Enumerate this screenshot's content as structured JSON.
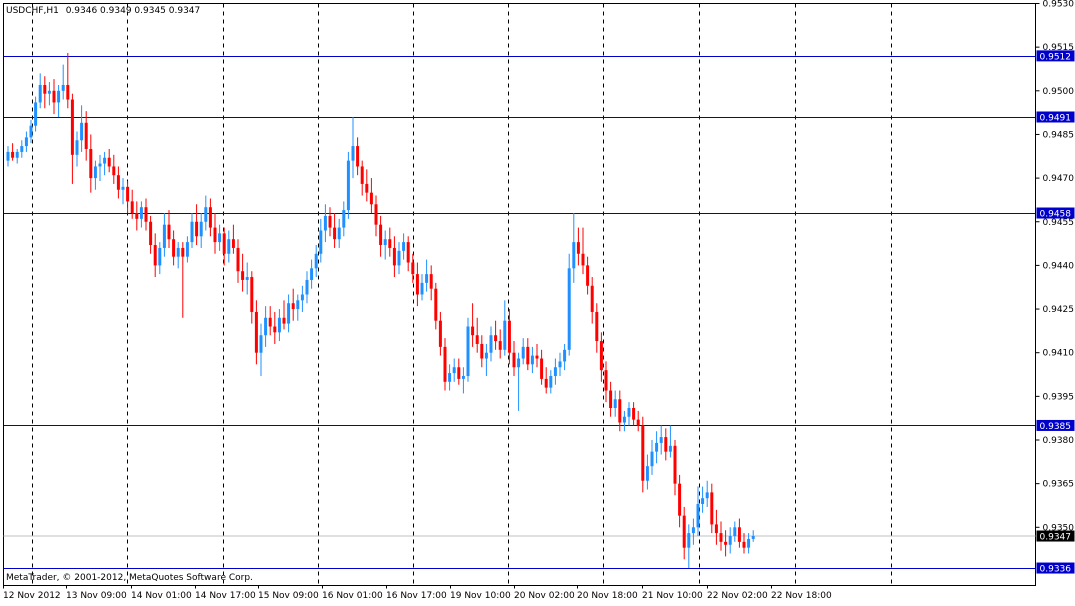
{
  "header": {
    "symbol": "USDCHF,H1",
    "ohlc": "0.9346 0.9349 0.9345 0.9347"
  },
  "footer": {
    "copyright": "MetaTrader, © 2001-2012, MetaQuotes Software Corp."
  },
  "colors": {
    "bull": "#1e90ff",
    "bear": "#ff0000",
    "level_line": "#0000cd",
    "grid": "#000000",
    "axis_text": "#000000",
    "current_price_bg": "#000000",
    "current_price_text": "#ffffff"
  },
  "chart_data": {
    "type": "candlestick",
    "symbol": "USDCHF",
    "timeframe": "H1",
    "title": "USDCHF,H1 0.9346 0.9349 0.9345 0.9347",
    "ylim": [
      0.933,
      0.953
    ],
    "y_ticks": [
      "0.9530",
      "0.9515",
      "0.9500",
      "0.9485",
      "0.9470",
      "0.9455",
      "0.9440",
      "0.9425",
      "0.9410",
      "0.9395",
      "0.9380",
      "0.9365",
      "0.9350"
    ],
    "x_tick_labels": [
      "12 Nov 2012",
      "13 Nov 09:00",
      "14 Nov 01:00",
      "14 Nov 17:00",
      "15 Nov 09:00",
      "16 Nov 01:00",
      "16 Nov 17:00",
      "19 Nov 10:00",
      "20 Nov 02:00",
      "20 Nov 18:00",
      "21 Nov 10:00",
      "22 Nov 02:00",
      "22 Nov 18:00"
    ],
    "horizontal_levels": [
      {
        "value": 0.9512,
        "label": "0.9512"
      },
      {
        "value": 0.9491,
        "label": "0.9491"
      },
      {
        "value": 0.9458,
        "label": "0.9458"
      },
      {
        "value": 0.9385,
        "label": "0.9385"
      },
      {
        "value": 0.9336,
        "label": "0.9336"
      }
    ],
    "current_price": {
      "value": 0.9347,
      "label": "0.9347"
    },
    "grid": "vertical-dashed",
    "candles": [
      [
        0.9476,
        0.9481,
        0.9474,
        0.9479
      ],
      [
        0.9479,
        0.9482,
        0.9476,
        0.9477
      ],
      [
        0.9477,
        0.948,
        0.9475,
        0.9479
      ],
      [
        0.9479,
        0.9483,
        0.9477,
        0.9481
      ],
      [
        0.9481,
        0.9486,
        0.9479,
        0.9484
      ],
      [
        0.9484,
        0.949,
        0.9482,
        0.9488
      ],
      [
        0.9488,
        0.9498,
        0.9486,
        0.9496
      ],
      [
        0.9496,
        0.9506,
        0.9494,
        0.9502
      ],
      [
        0.9502,
        0.9505,
        0.9494,
        0.9499
      ],
      [
        0.9499,
        0.9503,
        0.9495,
        0.95
      ],
      [
        0.95,
        0.9504,
        0.9492,
        0.9496
      ],
      [
        0.9496,
        0.9502,
        0.9491,
        0.95
      ],
      [
        0.95,
        0.9509,
        0.9497,
        0.9502
      ],
      [
        0.9502,
        0.9513,
        0.9494,
        0.9497
      ],
      [
        0.9497,
        0.9499,
        0.9468,
        0.9478
      ],
      [
        0.9478,
        0.9486,
        0.9474,
        0.9483
      ],
      [
        0.9483,
        0.9495,
        0.9479,
        0.9489
      ],
      [
        0.9489,
        0.9493,
        0.9476,
        0.948
      ],
      [
        0.948,
        0.9485,
        0.9465,
        0.947
      ],
      [
        0.947,
        0.9476,
        0.9466,
        0.9474
      ],
      [
        0.9474,
        0.9478,
        0.9469,
        0.9475
      ],
      [
        0.9475,
        0.9479,
        0.9471,
        0.9477
      ],
      [
        0.9477,
        0.948,
        0.9472,
        0.9474
      ],
      [
        0.9474,
        0.9478,
        0.9468,
        0.9471
      ],
      [
        0.9471,
        0.9474,
        0.9463,
        0.9466
      ],
      [
        0.9466,
        0.947,
        0.9461,
        0.9467
      ],
      [
        0.9467,
        0.9469,
        0.9458,
        0.9462
      ],
      [
        0.9462,
        0.9466,
        0.9456,
        0.9458
      ],
      [
        0.9458,
        0.9462,
        0.9452,
        0.9456
      ],
      [
        0.9456,
        0.9462,
        0.9453,
        0.946
      ],
      [
        0.946,
        0.9463,
        0.9452,
        0.9455
      ],
      [
        0.9455,
        0.9457,
        0.9444,
        0.9447
      ],
      [
        0.9447,
        0.9451,
        0.9436,
        0.944
      ],
      [
        0.944,
        0.9448,
        0.9437,
        0.9446
      ],
      [
        0.9446,
        0.9458,
        0.9443,
        0.9454
      ],
      [
        0.9454,
        0.9459,
        0.9446,
        0.9449
      ],
      [
        0.9449,
        0.9452,
        0.944,
        0.9443
      ],
      [
        0.9443,
        0.9448,
        0.9439,
        0.9446
      ],
      [
        0.9446,
        0.9448,
        0.9422,
        0.9443
      ],
      [
        0.9443,
        0.945,
        0.9441,
        0.9448
      ],
      [
        0.9448,
        0.9458,
        0.9446,
        0.9455
      ],
      [
        0.9455,
        0.9461,
        0.9447,
        0.945
      ],
      [
        0.945,
        0.9458,
        0.9446,
        0.9455
      ],
      [
        0.9455,
        0.9464,
        0.9452,
        0.946
      ],
      [
        0.946,
        0.9463,
        0.945,
        0.9453
      ],
      [
        0.9453,
        0.9458,
        0.9444,
        0.9448
      ],
      [
        0.9448,
        0.9454,
        0.9445,
        0.9451
      ],
      [
        0.9451,
        0.9453,
        0.944,
        0.9444
      ],
      [
        0.9444,
        0.9452,
        0.9441,
        0.9449
      ],
      [
        0.9449,
        0.9454,
        0.9444,
        0.9446
      ],
      [
        0.9446,
        0.9449,
        0.9434,
        0.9438
      ],
      [
        0.9438,
        0.9444,
        0.9431,
        0.9435
      ],
      [
        0.9435,
        0.9441,
        0.943,
        0.9436
      ],
      [
        0.9436,
        0.9438,
        0.942,
        0.9424
      ],
      [
        0.9424,
        0.9428,
        0.9406,
        0.941
      ],
      [
        0.941,
        0.942,
        0.9402,
        0.9416
      ],
      [
        0.9416,
        0.9426,
        0.9412,
        0.9422
      ],
      [
        0.9422,
        0.9426,
        0.9416,
        0.9419
      ],
      [
        0.9419,
        0.9424,
        0.9413,
        0.9417
      ],
      [
        0.9417,
        0.9425,
        0.9414,
        0.9422
      ],
      [
        0.9422,
        0.9428,
        0.9418,
        0.942
      ],
      [
        0.942,
        0.943,
        0.9417,
        0.9427
      ],
      [
        0.9427,
        0.9432,
        0.9421,
        0.9425
      ],
      [
        0.9425,
        0.943,
        0.9421,
        0.9428
      ],
      [
        0.9428,
        0.9433,
        0.9424,
        0.943
      ],
      [
        0.943,
        0.9438,
        0.9427,
        0.9435
      ],
      [
        0.9435,
        0.9442,
        0.9432,
        0.9439
      ],
      [
        0.9439,
        0.9447,
        0.9436,
        0.9444
      ],
      [
        0.9444,
        0.9456,
        0.9441,
        0.9452
      ],
      [
        0.9452,
        0.9461,
        0.9448,
        0.9457
      ],
      [
        0.9457,
        0.946,
        0.945,
        0.9453
      ],
      [
        0.9453,
        0.9458,
        0.9446,
        0.9449
      ],
      [
        0.9449,
        0.9456,
        0.9446,
        0.9453
      ],
      [
        0.9453,
        0.9462,
        0.945,
        0.9459
      ],
      [
        0.9459,
        0.9479,
        0.9456,
        0.9476
      ],
      [
        0.9476,
        0.9491,
        0.947,
        0.9481
      ],
      [
        0.9481,
        0.9484,
        0.9471,
        0.9474
      ],
      [
        0.9474,
        0.9476,
        0.9464,
        0.9468
      ],
      [
        0.9468,
        0.9473,
        0.9462,
        0.9465
      ],
      [
        0.9465,
        0.947,
        0.9458,
        0.9461
      ],
      [
        0.9461,
        0.9464,
        0.945,
        0.9454
      ],
      [
        0.9454,
        0.9457,
        0.9443,
        0.9447
      ],
      [
        0.9447,
        0.9452,
        0.9442,
        0.9449
      ],
      [
        0.9449,
        0.9453,
        0.9443,
        0.9446
      ],
      [
        0.9446,
        0.945,
        0.9436,
        0.944
      ],
      [
        0.944,
        0.9448,
        0.9437,
        0.9445
      ],
      [
        0.9445,
        0.9451,
        0.9442,
        0.9448
      ],
      [
        0.9448,
        0.945,
        0.9438,
        0.9441
      ],
      [
        0.9441,
        0.9444,
        0.9434,
        0.9437
      ],
      [
        0.9437,
        0.9441,
        0.9426,
        0.943
      ],
      [
        0.943,
        0.9437,
        0.9428,
        0.9434
      ],
      [
        0.9434,
        0.9442,
        0.9431,
        0.9437
      ],
      [
        0.9437,
        0.944,
        0.9428,
        0.9432
      ],
      [
        0.9432,
        0.9434,
        0.9418,
        0.9421
      ],
      [
        0.9421,
        0.9424,
        0.9409,
        0.9412
      ],
      [
        0.9412,
        0.9415,
        0.9397,
        0.94
      ],
      [
        0.94,
        0.9406,
        0.9397,
        0.9403
      ],
      [
        0.9403,
        0.9408,
        0.94,
        0.9405
      ],
      [
        0.9405,
        0.9408,
        0.9399,
        0.9401
      ],
      [
        0.9401,
        0.9405,
        0.9396,
        0.9402
      ],
      [
        0.9402,
        0.9422,
        0.94,
        0.9419
      ],
      [
        0.9419,
        0.9427,
        0.9412,
        0.9416
      ],
      [
        0.9416,
        0.9422,
        0.941,
        0.9413
      ],
      [
        0.9413,
        0.9416,
        0.9405,
        0.9408
      ],
      [
        0.9408,
        0.9413,
        0.9402,
        0.941
      ],
      [
        0.941,
        0.9419,
        0.9407,
        0.9416
      ],
      [
        0.9416,
        0.9421,
        0.9411,
        0.9414
      ],
      [
        0.9414,
        0.9418,
        0.9408,
        0.9411
      ],
      [
        0.9411,
        0.9428,
        0.9409,
        0.9421
      ],
      [
        0.9421,
        0.9425,
        0.9406,
        0.941
      ],
      [
        0.941,
        0.9414,
        0.9402,
        0.9405
      ],
      [
        0.9405,
        0.941,
        0.939,
        0.9408
      ],
      [
        0.9408,
        0.9415,
        0.9406,
        0.9412
      ],
      [
        0.9412,
        0.9415,
        0.9404,
        0.9406
      ],
      [
        0.9406,
        0.9412,
        0.9403,
        0.9409
      ],
      [
        0.9409,
        0.9413,
        0.9405,
        0.9408
      ],
      [
        0.9408,
        0.9411,
        0.9399,
        0.9401
      ],
      [
        0.9401,
        0.9405,
        0.9396,
        0.9398
      ],
      [
        0.9398,
        0.9404,
        0.9396,
        0.9402
      ],
      [
        0.9402,
        0.9408,
        0.9399,
        0.9405
      ],
      [
        0.9405,
        0.941,
        0.9402,
        0.9407
      ],
      [
        0.9407,
        0.9413,
        0.9404,
        0.9411
      ],
      [
        0.9411,
        0.9444,
        0.9409,
        0.9439
      ],
      [
        0.9439,
        0.9458,
        0.9434,
        0.9448
      ],
      [
        0.9448,
        0.9453,
        0.944,
        0.9444
      ],
      [
        0.9444,
        0.9453,
        0.9437,
        0.944
      ],
      [
        0.944,
        0.9443,
        0.943,
        0.9433
      ],
      [
        0.9433,
        0.9436,
        0.942,
        0.9424
      ],
      [
        0.9424,
        0.9427,
        0.941,
        0.9414
      ],
      [
        0.9414,
        0.9417,
        0.94,
        0.9404
      ],
      [
        0.9404,
        0.9407,
        0.9393,
        0.9397
      ],
      [
        0.9397,
        0.94,
        0.9388,
        0.9391
      ],
      [
        0.9391,
        0.9397,
        0.9388,
        0.9394
      ],
      [
        0.9394,
        0.9397,
        0.9383,
        0.9386
      ],
      [
        0.9386,
        0.939,
        0.9383,
        0.9388
      ],
      [
        0.9388,
        0.9393,
        0.9385,
        0.9391
      ],
      [
        0.9391,
        0.9393,
        0.9385,
        0.9387
      ],
      [
        0.9387,
        0.939,
        0.9383,
        0.9385
      ],
      [
        0.9385,
        0.9388,
        0.9362,
        0.9366
      ],
      [
        0.9366,
        0.9375,
        0.9363,
        0.9371
      ],
      [
        0.9371,
        0.938,
        0.9368,
        0.9376
      ],
      [
        0.9376,
        0.9383,
        0.9372,
        0.9379
      ],
      [
        0.9379,
        0.9385,
        0.9375,
        0.9381
      ],
      [
        0.9381,
        0.9384,
        0.9373,
        0.9376
      ],
      [
        0.9376,
        0.9385,
        0.9374,
        0.9378
      ],
      [
        0.9378,
        0.938,
        0.9361,
        0.9365
      ],
      [
        0.9365,
        0.9368,
        0.935,
        0.9354
      ],
      [
        0.9354,
        0.9357,
        0.9339,
        0.9343
      ],
      [
        0.9343,
        0.9351,
        0.9336,
        0.9348
      ],
      [
        0.9348,
        0.9353,
        0.9344,
        0.935
      ],
      [
        0.935,
        0.9364,
        0.9347,
        0.9358
      ],
      [
        0.9358,
        0.9364,
        0.9355,
        0.936
      ],
      [
        0.936,
        0.9366,
        0.9357,
        0.9362
      ],
      [
        0.9362,
        0.9365,
        0.9348,
        0.9351
      ],
      [
        0.9351,
        0.9356,
        0.9344,
        0.9348
      ],
      [
        0.9348,
        0.9352,
        0.9342,
        0.9345
      ],
      [
        0.9345,
        0.9349,
        0.934,
        0.9344
      ],
      [
        0.9344,
        0.935,
        0.9341,
        0.9347
      ],
      [
        0.9347,
        0.9352,
        0.9345,
        0.935
      ],
      [
        0.935,
        0.9353,
        0.9343,
        0.9345
      ],
      [
        0.9345,
        0.9348,
        0.9341,
        0.9343
      ],
      [
        0.9343,
        0.9348,
        0.9341,
        0.9346
      ],
      [
        0.9346,
        0.9349,
        0.9345,
        0.9347
      ]
    ]
  }
}
